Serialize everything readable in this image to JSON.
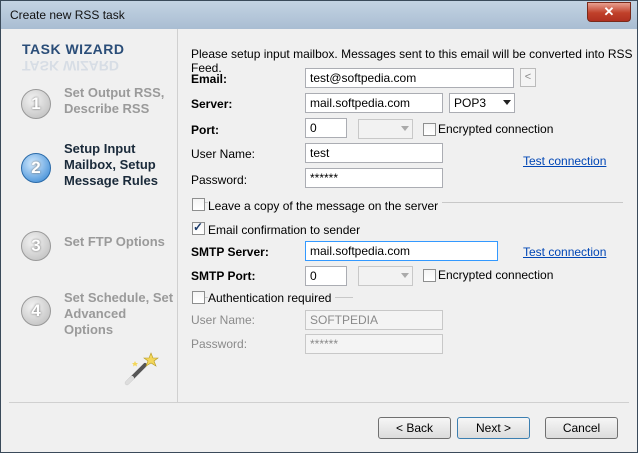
{
  "window": {
    "title": "Create new RSS task",
    "close_symbol": "✕"
  },
  "sidebar": {
    "title": "TASK WIZARD",
    "steps": [
      {
        "number": "1",
        "label": "Set Output RSS, Describe RSS"
      },
      {
        "number": "2",
        "label": "Setup Input Mailbox, Setup Message Rules"
      },
      {
        "number": "3",
        "label": "Set FTP Options"
      },
      {
        "number": "4",
        "label": "Set Schedule, Set Advanced Options"
      }
    ]
  },
  "form": {
    "intro": "Please setup input mailbox. Messages sent to this email will be converted into RSS Feed.",
    "email_label": "Email:",
    "email_value": "test@softpedia.com",
    "email_button": "<",
    "server_label": "Server:",
    "server_value": "mail.softpedia.com",
    "protocol_value": "POP3",
    "port_label": "Port:",
    "port_value": "0",
    "encrypted_label": "Encrypted connection",
    "username_label": "User Name:",
    "username_value": "test",
    "test_connection": "Test connection",
    "password_label": "Password:",
    "password_value": "******",
    "leave_copy_label": "Leave a copy of the message on the server",
    "email_confirm_label": "Email confirmation to sender",
    "smtp_server_label": "SMTP Server:",
    "smtp_server_value": "mail.softpedia.com",
    "smtp_test_connection": "Test connection",
    "smtp_port_label": "SMTP Port:",
    "smtp_port_value": "0",
    "smtp_encrypted_label": "Encrypted connection",
    "auth_label": "Authentication required",
    "auth_username_label": "User Name:",
    "auth_username_value": "SOFTPEDIA",
    "auth_password_label": "Password:",
    "auth_password_value": "******"
  },
  "buttons": {
    "back": "< Back",
    "next": "Next >",
    "cancel": "Cancel"
  },
  "colors": {
    "accent": "#2a7fd0",
    "link": "#0046b5",
    "wizard_title": "#2a4d78"
  }
}
